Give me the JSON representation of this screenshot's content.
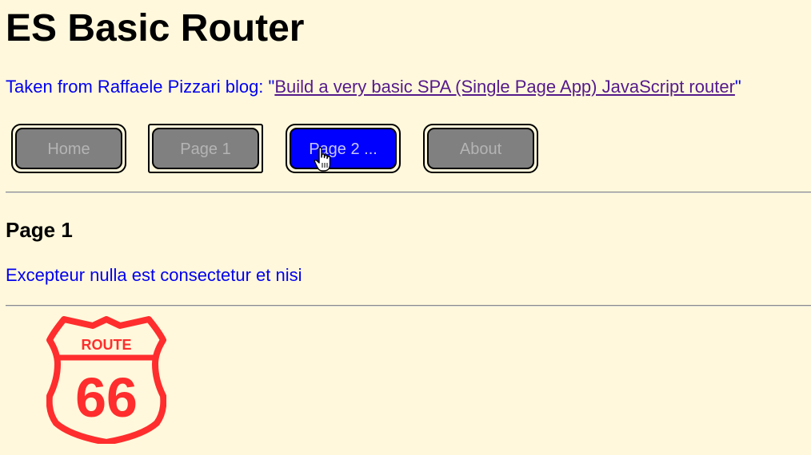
{
  "header": {
    "title": "ES Basic Router"
  },
  "credit": {
    "prefix": "Taken from Raffaele Pizzari blog: \"",
    "link_text": "Build a very basic SPA (Single Page App) JavaScript router",
    "suffix": "\""
  },
  "nav": {
    "items": [
      {
        "label": "Home"
      },
      {
        "label": "Page 1"
      },
      {
        "label": "Page 2 ..."
      },
      {
        "label": "About"
      }
    ],
    "active_index": 2
  },
  "content": {
    "heading": "Page 1",
    "text": "Excepteur nulla est consectetur et nisi"
  },
  "logo": {
    "top_text": "ROUTE",
    "number": "66",
    "color": "#ff2d2d"
  },
  "colors": {
    "background": "#fff8dc",
    "button_inactive": "#808080",
    "button_active": "#0000ff",
    "body_text": "#0000ee",
    "link_visited": "#551a8b"
  }
}
